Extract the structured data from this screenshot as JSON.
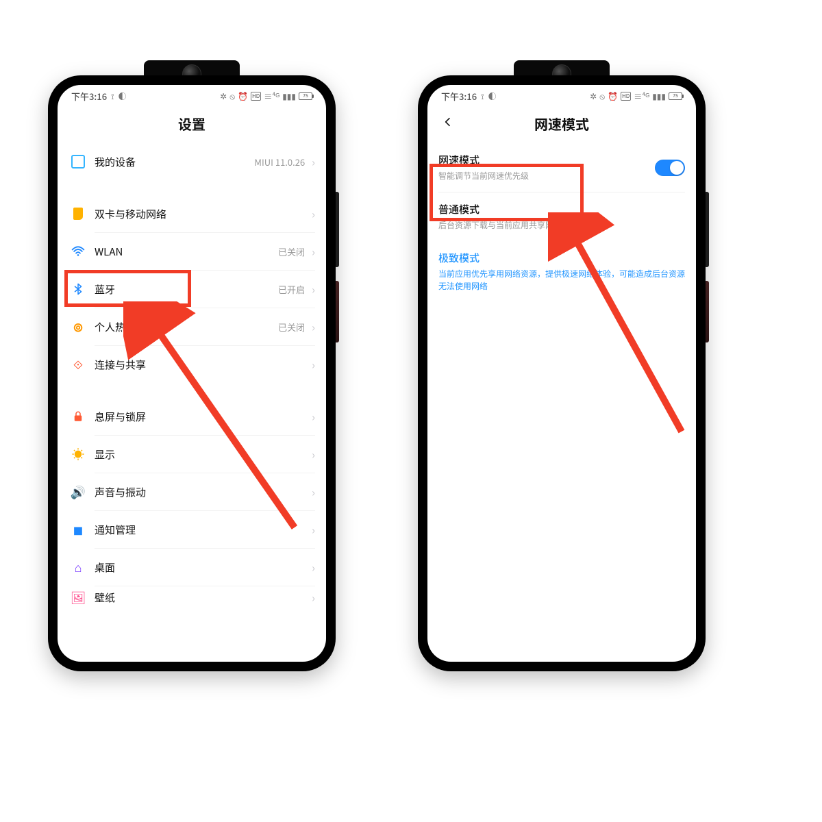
{
  "status": {
    "time": "下午3:16",
    "battery": "75"
  },
  "left": {
    "title": "设置",
    "rows": {
      "device": {
        "label": "我的设备",
        "hint": "MIUI 11.0.26"
      },
      "sim": {
        "label": "双卡与移动网络"
      },
      "wlan": {
        "label": "WLAN",
        "hint": "已关闭"
      },
      "bt": {
        "label": "蓝牙",
        "hint": "已开启"
      },
      "hotspot": {
        "label": "个人热点",
        "hint": "已关闭"
      },
      "connect": {
        "label": "连接与共享"
      },
      "lock": {
        "label": "息屏与锁屏"
      },
      "display": {
        "label": "显示"
      },
      "sound": {
        "label": "声音与振动"
      },
      "notif": {
        "label": "通知管理"
      },
      "desktop": {
        "label": "桌面"
      },
      "wall": {
        "label": "壁纸"
      }
    }
  },
  "right": {
    "title": "网速模式",
    "mode_switch": {
      "title": "网速模式",
      "sub": "智能调节当前网速优先级",
      "on": true
    },
    "normal": {
      "title": "普通模式",
      "sub": "后台资源下载与当前应用共享网络资源"
    },
    "extreme": {
      "title": "极致模式",
      "sub": "当前应用优先享用网络资源，提供极速网络体验，可能造成后台资源无法使用网络"
    }
  }
}
